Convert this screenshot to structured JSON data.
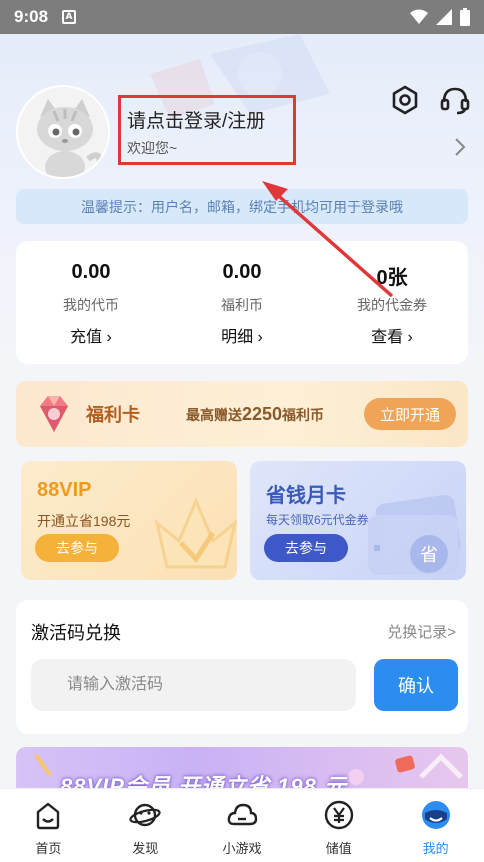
{
  "status_bar": {
    "time": "9:08",
    "app_badge": "A"
  },
  "header": {
    "login_title": "请点击登录/注册",
    "welcome": "欢迎您~"
  },
  "tip": "温馨提示：用户名，邮箱，绑定手机均可用于登录哦",
  "wallet": [
    {
      "value": "0.00",
      "label": "我的代币",
      "action": "充值 ›"
    },
    {
      "value": "0.00",
      "label": "福利币",
      "action": "明细 ›"
    },
    {
      "value": "0张",
      "label": "我的代金券",
      "action": "查看 ›"
    }
  ],
  "welfare_card": {
    "name": "福利卡",
    "desc_prefix": "最高赠送",
    "desc_amount": "2250",
    "desc_suffix": "福利币",
    "button": "立即开通"
  },
  "vip_card": {
    "title": "88VIP",
    "subtitle": "开通立省198元",
    "button": "去参与"
  },
  "month_card": {
    "title": "省钱月卡",
    "subtitle": "每天领取6元代金券",
    "button": "去参与",
    "badge": "省"
  },
  "redeem": {
    "title": "激活码兑换",
    "record": "兑换记录>",
    "placeholder": "请输入激活码",
    "confirm": "确认"
  },
  "banner_text": "88VIP会员 开通立省 198 元",
  "tabs": [
    {
      "label": "首页",
      "icon": "home-icon"
    },
    {
      "label": "发现",
      "icon": "planet-icon"
    },
    {
      "label": "小游戏",
      "icon": "cloud-icon"
    },
    {
      "label": "储值",
      "icon": "yen-coin-icon"
    },
    {
      "label": "我的",
      "icon": "profile-face-icon"
    }
  ],
  "colors": {
    "accent": "#2d8cf0",
    "highlight": "#e0383a",
    "vip": "#ef9a1f",
    "month": "#3f58c8"
  }
}
